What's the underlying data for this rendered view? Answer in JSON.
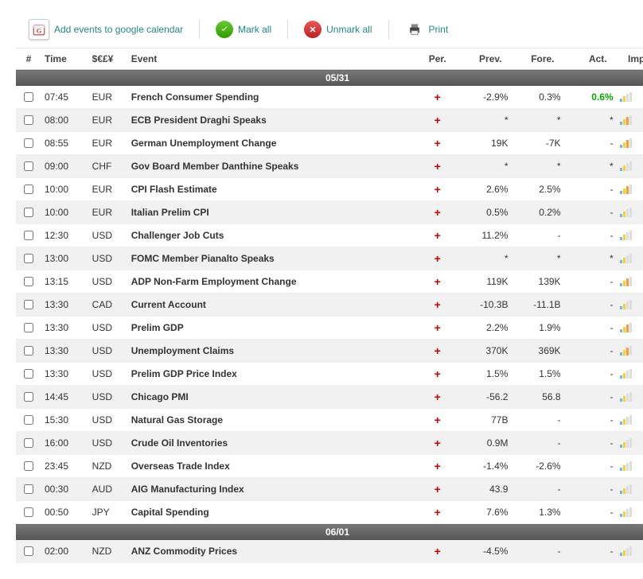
{
  "toolbar": {
    "google": "Add events to google calendar",
    "markAll": "Mark all",
    "unmarkAll": "Unmark all",
    "print": "Print"
  },
  "columns": {
    "chk": "#",
    "time": "Time",
    "cur": "$€£¥",
    "event": "Event",
    "per": "Per.",
    "prev": "Prev.",
    "fore": "Fore.",
    "act": "Act.",
    "imp": "Imp."
  },
  "groups": [
    {
      "date": "05/31",
      "rows": [
        {
          "time": "07:45",
          "cur": "EUR",
          "event": "French Consumer Spending",
          "prev": "-2.9%",
          "fore": "0.3%",
          "act": "0.6%",
          "actCls": "act-pos",
          "imp": 2
        },
        {
          "time": "08:00",
          "cur": "EUR",
          "event": "ECB President Draghi Speaks",
          "prev": "*",
          "fore": "*",
          "act": "*",
          "imp": 3
        },
        {
          "time": "08:55",
          "cur": "EUR",
          "event": "German Unemployment Change",
          "prev": "19K",
          "fore": "-7K",
          "act": "-",
          "imp": 3
        },
        {
          "time": "09:00",
          "cur": "CHF",
          "event": "Gov Board Member Danthine Speaks",
          "prev": "*",
          "fore": "*",
          "act": "*",
          "imp": 2
        },
        {
          "time": "10:00",
          "cur": "EUR",
          "event": "CPI Flash Estimate",
          "prev": "2.6%",
          "fore": "2.5%",
          "act": "-",
          "imp": 3
        },
        {
          "time": "10:00",
          "cur": "EUR",
          "event": "Italian Prelim CPI",
          "prev": "0.5%",
          "fore": "0.2%",
          "act": "-",
          "imp": 2
        },
        {
          "time": "12:30",
          "cur": "USD",
          "event": "Challenger Job Cuts",
          "prev": "11.2%",
          "fore": "-",
          "act": "-",
          "imp": 2
        },
        {
          "time": "13:00",
          "cur": "USD",
          "event": "FOMC Member Pianalto Speaks",
          "prev": "*",
          "fore": "*",
          "act": "*",
          "imp": 2
        },
        {
          "time": "13:15",
          "cur": "USD",
          "event": "ADP Non-Farm Employment Change",
          "prev": "119K",
          "fore": "139K",
          "act": "-",
          "imp": 3
        },
        {
          "time": "13:30",
          "cur": "CAD",
          "event": "Current Account",
          "prev": "-10.3B",
          "fore": "-11.1B",
          "act": "-",
          "imp": 2
        },
        {
          "time": "13:30",
          "cur": "USD",
          "event": "Prelim GDP",
          "prev": "2.2%",
          "fore": "1.9%",
          "act": "-",
          "imp": 3
        },
        {
          "time": "13:30",
          "cur": "USD",
          "event": "Unemployment Claims",
          "prev": "370K",
          "fore": "369K",
          "act": "-",
          "imp": 3
        },
        {
          "time": "13:30",
          "cur": "USD",
          "event": "Prelim GDP Price Index",
          "prev": "1.5%",
          "fore": "1.5%",
          "act": "-",
          "imp": 2
        },
        {
          "time": "14:45",
          "cur": "USD",
          "event": "Chicago PMI",
          "prev": "-56.2",
          "fore": "56.8",
          "act": "-",
          "imp": 2
        },
        {
          "time": "15:30",
          "cur": "USD",
          "event": "Natural Gas Storage",
          "prev": "77B",
          "fore": "-",
          "act": "-",
          "imp": 2
        },
        {
          "time": "16:00",
          "cur": "USD",
          "event": "Crude Oil Inventories",
          "prev": "0.9M",
          "fore": "-",
          "act": "-",
          "imp": 2
        },
        {
          "time": "23:45",
          "cur": "NZD",
          "event": "Overseas Trade Index",
          "prev": "-1.4%",
          "fore": "-2.6%",
          "act": "-",
          "imp": 2
        },
        {
          "time": "00:30",
          "cur": "AUD",
          "event": "AIG Manufacturing Index",
          "prev": "43.9",
          "fore": "-",
          "act": "-",
          "imp": 2
        },
        {
          "time": "00:50",
          "cur": "JPY",
          "event": "Capital Spending",
          "prev": "7.6%",
          "fore": "1.3%",
          "act": "-",
          "imp": 2
        }
      ]
    },
    {
      "date": "06/01",
      "rows": [
        {
          "time": "02:00",
          "cur": "NZD",
          "event": "ANZ Commodity Prices",
          "prev": "-4.5%",
          "fore": "-",
          "act": "-",
          "imp": 2
        }
      ]
    }
  ]
}
